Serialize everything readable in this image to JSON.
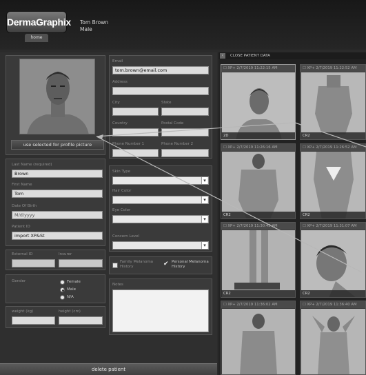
{
  "header": {
    "logo": "DermaGraphix",
    "home_tab": "home",
    "patient_name": "Tom Brown",
    "patient_sex": "Male"
  },
  "profile": {
    "button_label": "use selected for profile picture"
  },
  "form": {
    "last_name_label": "Last Name (required)",
    "last_name": "Brown",
    "first_name_label": "First Name",
    "first_name": "Tom",
    "dob_label": "Date Of Birth",
    "dob": "M/d/yyyy",
    "patient_id_label": "Patient ID",
    "patient_id": "import XP&St",
    "external_id_label": "External ID",
    "insurance_label": "Insurer",
    "gender_label": "Gender",
    "gender_options": [
      "Female",
      "Male",
      "N/A"
    ],
    "weight_label": "weight (kg)",
    "height_label": "height (cm)",
    "email_label": "Email",
    "email": "tom.brown@email.com",
    "address_label": "Address",
    "city_label": "City",
    "state_label": "State",
    "country_label": "Country",
    "postal_label": "Postal Code",
    "phone1_label": "Phone Number 1",
    "phone2_label": "Phone Number 2",
    "skin_type_label": "Skin Type",
    "hair_color_label": "Hair Color",
    "eye_color_label": "Eye Color",
    "concern_label": "Concern Level",
    "family_melanoma": "Family Melanoma History",
    "personal_melanoma": "Personal Melanoma History",
    "notes_label": "Notes"
  },
  "delete_button": "delete patient",
  "right": {
    "close_label": "CLOSE PATIENT DATA",
    "tiles": [
      {
        "header": "☐ XP+  2/7/2019 11:22:15 AM",
        "footer": "2D"
      },
      {
        "header": "☐ XP+  2/7/2019 11:22:52 AM",
        "footer": "CR2"
      },
      {
        "header": "☐ XP+  2/7/2019 11:26:16 AM",
        "footer": "CR2"
      },
      {
        "header": "☐ XP+  2/7/2019 11:26:52 AM",
        "footer": "CR2"
      },
      {
        "header": "☐ XP+  2/7/2019 11:30:43 AM",
        "footer": "CR2"
      },
      {
        "header": "☐ XP+  2/7/2019 11:31:07 AM",
        "footer": "CR2"
      },
      {
        "header": "☐ XP+  2/7/2019 11:36:02 AM",
        "footer": ""
      },
      {
        "header": "☐ XP+  2/7/2019 11:36:40 AM",
        "footer": ""
      }
    ]
  }
}
